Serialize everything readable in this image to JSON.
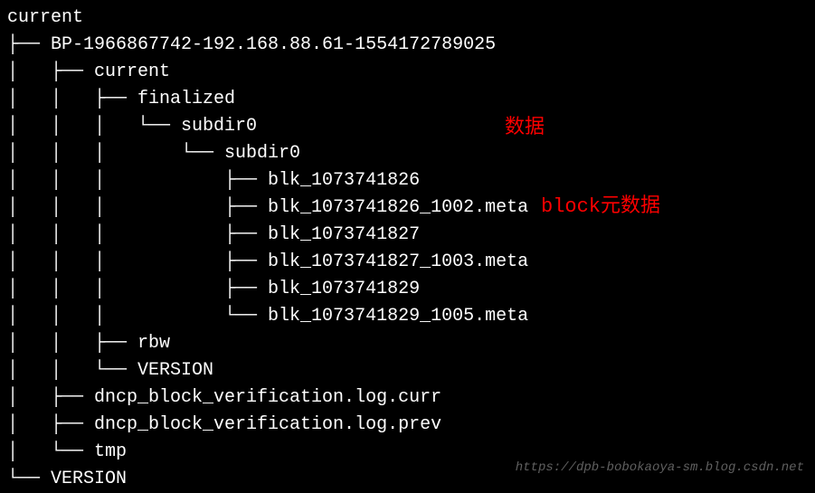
{
  "tree": {
    "root": "current",
    "lines": [
      "current",
      "├── BP-1966867742-192.168.88.61-1554172789025",
      "│   ├── current",
      "│   │   ├── finalized",
      "│   │   │   └── subdir0",
      "│   │   │       └── subdir0",
      "│   │   │           ├── blk_1073741826",
      "│   │   │           ├── blk_1073741826_1002.meta",
      "│   │   │           ├── blk_1073741827",
      "│   │   │           ├── blk_1073741827_1003.meta",
      "│   │   │           ├── blk_1073741829",
      "│   │   │           └── blk_1073741829_1005.meta",
      "│   │   ├── rbw",
      "│   │   └── VERSION",
      "│   ├── dncp_block_verification.log.curr",
      "│   ├── dncp_block_verification.log.prev",
      "│   └── tmp",
      "└── VERSION"
    ]
  },
  "annotations": {
    "data_label": "数据",
    "block_metadata_label": "block元数据"
  },
  "watermark": "https://dpb-bobokaoya-sm.blog.csdn.net"
}
